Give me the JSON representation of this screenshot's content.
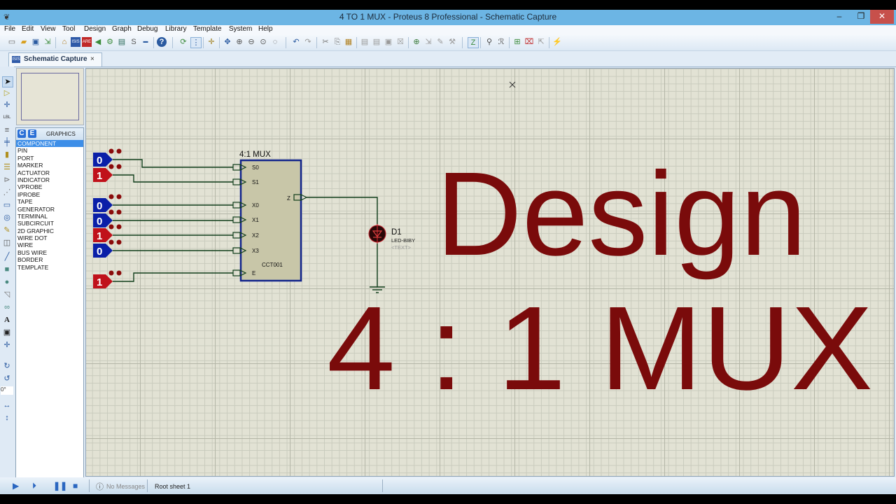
{
  "window": {
    "title": "4 TO 1 MUX - Proteus 8 Professional - Schematic Capture",
    "controls": {
      "minimize": "–",
      "maximize": "❐",
      "close": "✕"
    }
  },
  "menu": [
    "File",
    "Edit",
    "View",
    "Tool",
    "Design",
    "Graph",
    "Debug",
    "Library",
    "Template",
    "System",
    "Help"
  ],
  "toolbar": {
    "icons": [
      "new-file",
      "open-file",
      "save",
      "import",
      "home",
      "isis-schematic",
      "ares-pcb",
      "3d-viewer",
      "gerber-viewer",
      "bom",
      "design-explorer",
      "vsm-studio",
      "help",
      "refresh",
      "toggle-grid",
      "origin",
      "pan",
      "zoom-in",
      "zoom-out",
      "zoom-all",
      "zoom-area",
      "undo",
      "redo",
      "cut",
      "copy",
      "paste",
      "block-copy",
      "block-move",
      "block-rotate",
      "block-delete",
      "pick-device",
      "make-device",
      "packaging-tool",
      "decompose",
      "wire-autorouter",
      "search",
      "property-assignment",
      "new-sheet",
      "remove-sheet",
      "goto-child",
      "netlist-to-ares"
    ]
  },
  "tabs": [
    {
      "label": "Schematic Capture",
      "close": "×",
      "icon": "ISIS"
    }
  ],
  "device_panel": {
    "mode_buttons": [
      "C",
      "E"
    ],
    "header": "GRAPHICS",
    "items": [
      "COMPONENT",
      "PIN",
      "PORT",
      "MARKER",
      "ACTUATOR",
      "INDICATOR",
      "VPROBE",
      "IPROBE",
      "TAPE",
      "GENERATOR",
      "TERMINAL",
      "SUBCIRCUIT",
      "2D GRAPHIC",
      "WIRE DOT",
      "WIRE",
      "BUS WIRE",
      "BORDER",
      "TEMPLATE"
    ],
    "selected": "COMPONENT"
  },
  "left_tools": {
    "rotation_value": "0°"
  },
  "schematic": {
    "mux": {
      "title": "4:1 MUX",
      "ref": "CCT001",
      "inputs": [
        "S0",
        "S1",
        "X0",
        "X1",
        "X2",
        "X3",
        "E"
      ],
      "output": "Z"
    },
    "logic_states": [
      {
        "pin": "S0",
        "value": "0"
      },
      {
        "pin": "S1",
        "value": "1"
      },
      {
        "pin": "X0",
        "value": "0"
      },
      {
        "pin": "X1",
        "value": "0"
      },
      {
        "pin": "X2",
        "value": "1"
      },
      {
        "pin": "X3",
        "value": "0"
      },
      {
        "pin": "E",
        "value": "1"
      }
    ],
    "led": {
      "ref": "D1",
      "part": "LED-BIBY",
      "text": "<TEXT>"
    },
    "overlay_text": {
      "line1": "Design",
      "line2": "4 : 1 MUX"
    },
    "colors": {
      "logic_low": "#0a1fa8",
      "logic_high": "#c0111a",
      "overlay": "#7a0b0b",
      "wire": "#0f3d1a",
      "mux_fill": "#c8c6a8",
      "mux_border": "#12248c"
    }
  },
  "statusbar": {
    "messages": "No Messages",
    "sheet": "Root sheet 1"
  }
}
